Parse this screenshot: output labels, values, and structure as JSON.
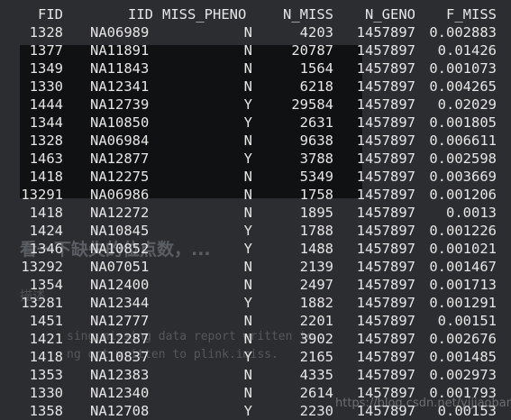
{
  "background": {
    "heading": "看一下缺失的位点数，...",
    "sub": "描述",
    "lines": [
      "sing  missing data report written to",
      "ng  ort written to plink.imiss."
    ],
    "watermark": "https://blog.csdn.net/yijiaobani"
  },
  "table": {
    "columns": [
      "FID",
      "IID",
      "MISS_PHENO",
      "N_MISS",
      "N_GENO",
      "F_MISS"
    ],
    "rows": [
      [
        "1328",
        "NA06989",
        "N",
        "4203",
        "1457897",
        "0.002883"
      ],
      [
        "1377",
        "NA11891",
        "N",
        "20787",
        "1457897",
        "0.01426"
      ],
      [
        "1349",
        "NA11843",
        "N",
        "1564",
        "1457897",
        "0.001073"
      ],
      [
        "1330",
        "NA12341",
        "N",
        "6218",
        "1457897",
        "0.004265"
      ],
      [
        "1444",
        "NA12739",
        "Y",
        "29584",
        "1457897",
        "0.02029"
      ],
      [
        "1344",
        "NA10850",
        "Y",
        "2631",
        "1457897",
        "0.001805"
      ],
      [
        "1328",
        "NA06984",
        "N",
        "9638",
        "1457897",
        "0.006611"
      ],
      [
        "1463",
        "NA12877",
        "Y",
        "3788",
        "1457897",
        "0.002598"
      ],
      [
        "1418",
        "NA12275",
        "N",
        "5349",
        "1457897",
        "0.003669"
      ],
      [
        "13291",
        "NA06986",
        "N",
        "1758",
        "1457897",
        "0.001206"
      ],
      [
        "1418",
        "NA12272",
        "N",
        "1895",
        "1457897",
        "0.0013"
      ],
      [
        "1424",
        "NA10845",
        "Y",
        "1788",
        "1457897",
        "0.001226"
      ],
      [
        "1346",
        "NA10852",
        "Y",
        "1488",
        "1457897",
        "0.001021"
      ],
      [
        "13292",
        "NA07051",
        "N",
        "2139",
        "1457897",
        "0.001467"
      ],
      [
        "1354",
        "NA12400",
        "N",
        "2497",
        "1457897",
        "0.001713"
      ],
      [
        "13281",
        "NA12344",
        "Y",
        "1882",
        "1457897",
        "0.001291"
      ],
      [
        "1451",
        "NA12777",
        "N",
        "2201",
        "1457897",
        "0.00151"
      ],
      [
        "1421",
        "NA12287",
        "N",
        "3902",
        "1457897",
        "0.002676"
      ],
      [
        "1418",
        "NA10837",
        "Y",
        "2165",
        "1457897",
        "0.001485"
      ],
      [
        "1353",
        "NA12383",
        "N",
        "4335",
        "1457897",
        "0.002973"
      ],
      [
        "1330",
        "NA12340",
        "N",
        "2614",
        "1457897",
        "0.001793"
      ],
      [
        "1358",
        "NA12708",
        "Y",
        "2230",
        "1457897",
        "0.00153"
      ]
    ]
  }
}
